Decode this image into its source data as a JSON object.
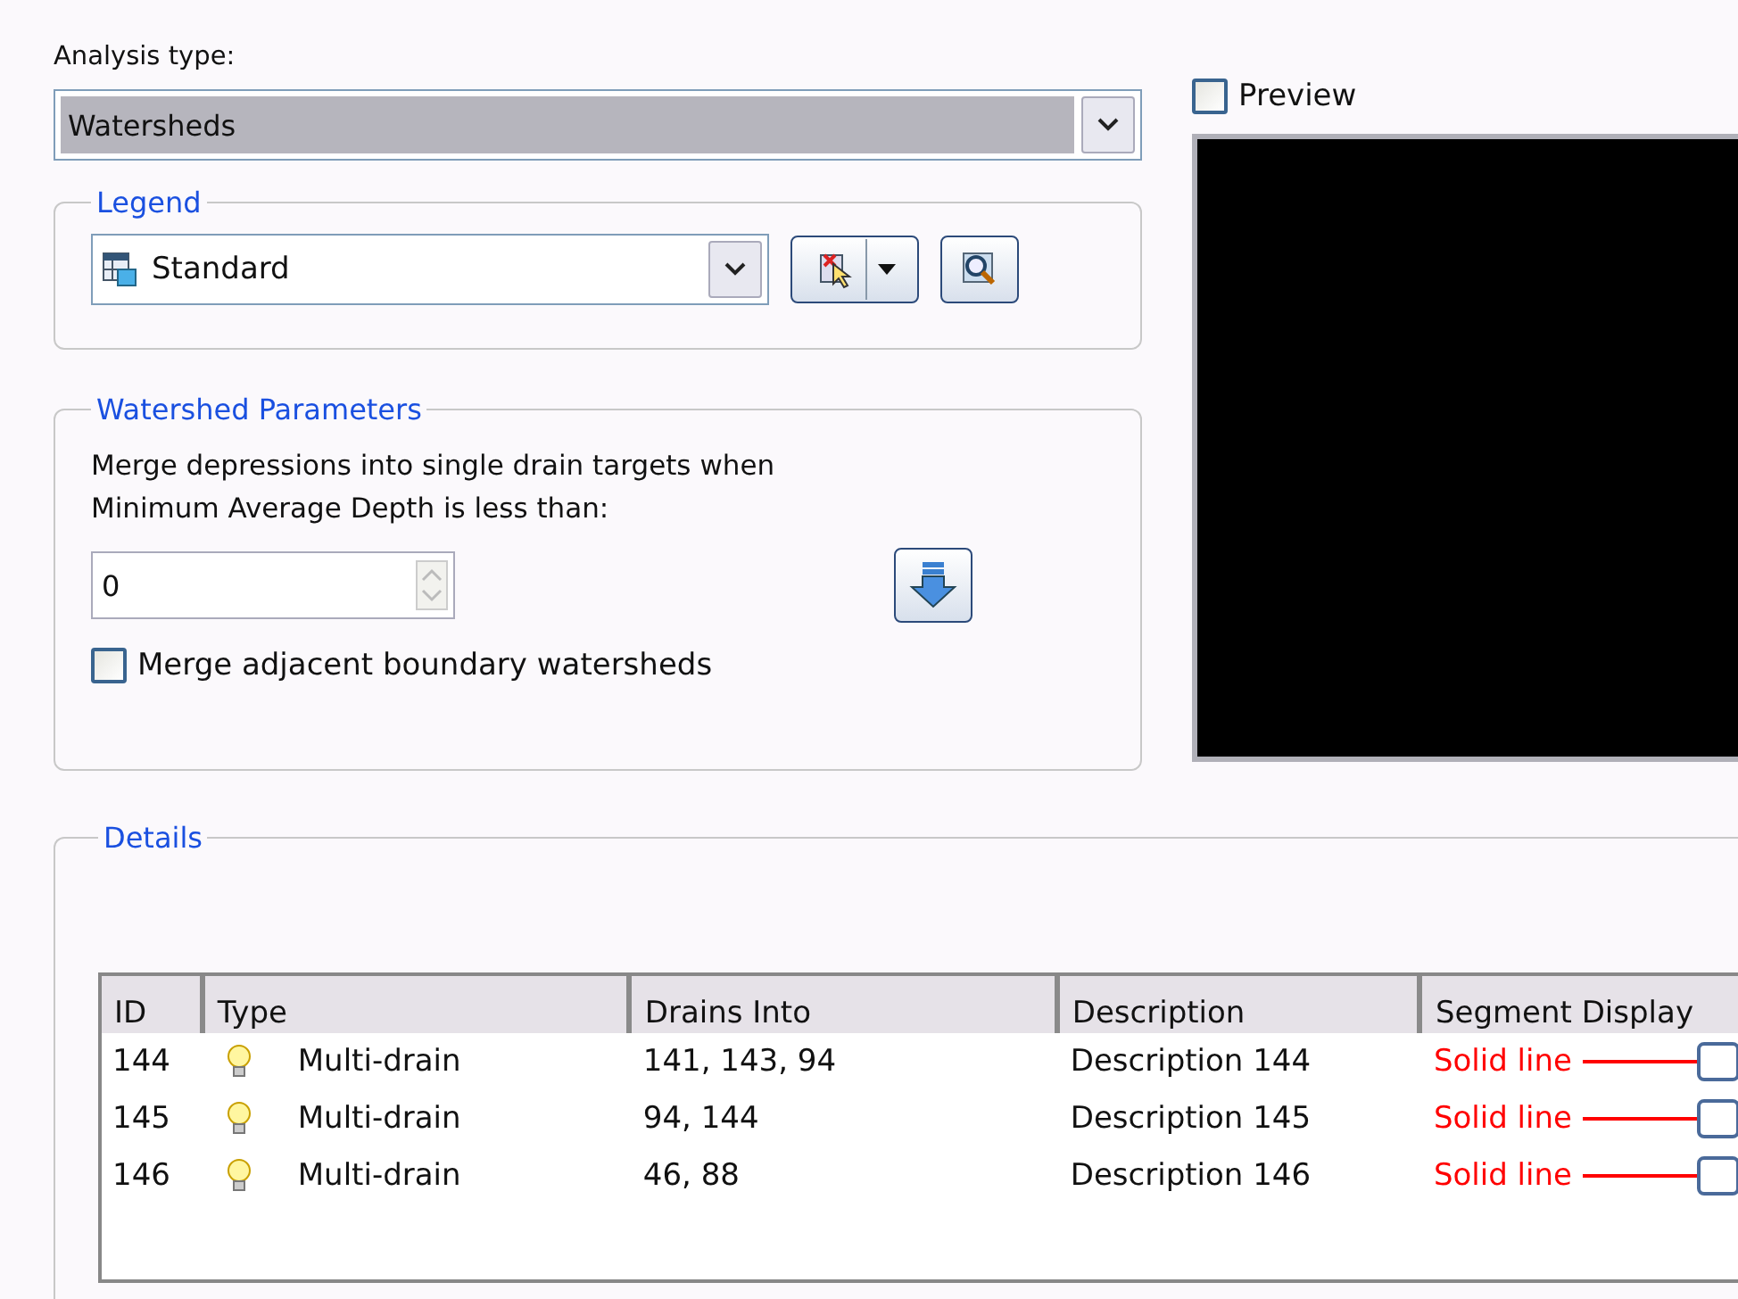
{
  "analysis_type": {
    "label": "Analysis type:",
    "value": "Watersheds"
  },
  "preview": {
    "label": "Preview",
    "checked": false
  },
  "legend": {
    "title": "Legend",
    "value": "Standard"
  },
  "watershed_parameters": {
    "title": "Watershed Parameters",
    "description": "Merge depressions into single drain targets when Minimum Average Depth is less than:",
    "depth_value": "0",
    "merge_adjacent": {
      "label": "Merge adjacent boundary watersheds",
      "checked": false
    }
  },
  "details": {
    "title": "Details",
    "columns": [
      "ID",
      "Type",
      "Drains Into",
      "Description",
      "Segment Display"
    ],
    "rows": [
      {
        "id": "144",
        "type": "Multi-drain",
        "drains_into": "141, 143, 94",
        "description": "Description 144",
        "segment_display": "Solid line"
      },
      {
        "id": "145",
        "type": "Multi-drain",
        "drains_into": "94, 144",
        "description": "Description 145",
        "segment_display": "Solid line"
      },
      {
        "id": "146",
        "type": "Multi-drain",
        "drains_into": "46, 88",
        "description": "Description 146",
        "segment_display": "Solid line"
      }
    ]
  }
}
